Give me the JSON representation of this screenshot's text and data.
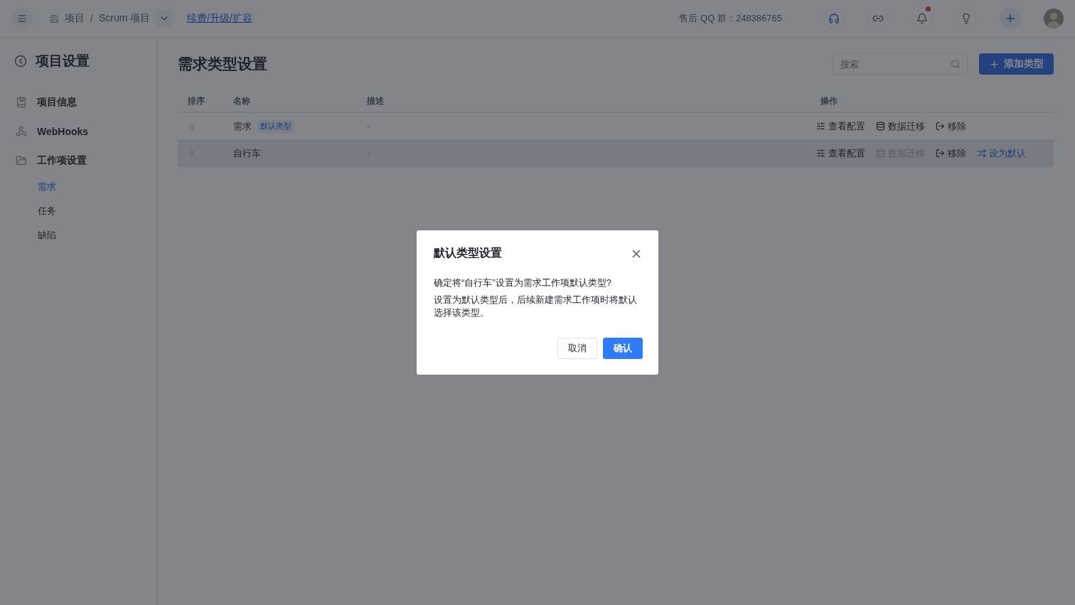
{
  "header": {
    "breadcrumb": [
      "项目",
      "Scrum 项目"
    ],
    "separator": "/",
    "renew_link": "续费/升级/扩容",
    "qq_group": "售后 QQ 群：248386765",
    "unread_dot": true,
    "icons": [
      {
        "kind": "support"
      },
      {
        "kind": "link"
      },
      {
        "kind": "bell"
      },
      {
        "kind": "bulb"
      },
      {
        "kind": "plus"
      },
      {
        "kind": "avatar"
      }
    ]
  },
  "sidebar": {
    "title": "项目设置",
    "items": [
      {
        "kind": "info",
        "label": "项目信息"
      },
      {
        "kind": "webhook",
        "label": "WebHooks"
      },
      {
        "kind": "folder",
        "label": "工作项设置"
      }
    ],
    "sub_items": [
      {
        "label": "需求",
        "selected": true
      },
      {
        "label": "任务",
        "selected": false
      },
      {
        "label": "缺陷",
        "selected": false
      }
    ]
  },
  "main": {
    "title": "需求类型设置",
    "search": {
      "placeholder": "搜索"
    },
    "add_button": "添加类型",
    "table": {
      "columns": [
        "排序",
        "名称",
        "描述",
        "操作"
      ],
      "rows": [
        {
          "name": "需求",
          "tag": "默认类型",
          "description": "-",
          "hovered": false,
          "actions": [
            {
              "kind": "config",
              "label": "查看配置",
              "disabled": false
            },
            {
              "kind": "migrate",
              "label": "数据迁移",
              "disabled": false
            },
            {
              "kind": "remove",
              "label": "移除",
              "disabled": false
            }
          ]
        },
        {
          "name": "自行车",
          "description": "-",
          "hovered": true,
          "actions": [
            {
              "kind": "config",
              "label": "查看配置",
              "disabled": false
            },
            {
              "kind": "migrate",
              "label": "数据迁移",
              "disabled": true
            },
            {
              "kind": "remove",
              "label": "移除",
              "disabled": false
            },
            {
              "kind": "default",
              "label": "设为默认",
              "disabled": false
            }
          ]
        }
      ]
    }
  },
  "dialog": {
    "title": "默认类型设置",
    "message": "确定将“自行车”设置为需求工作项默认类型?",
    "note": "设置为默认类型后，后续新建需求工作项时将默认选择该类型。",
    "buttons": [
      {
        "kind": "secondary",
        "label": "取消"
      },
      {
        "kind": "primary",
        "label": "确认"
      }
    ]
  }
}
